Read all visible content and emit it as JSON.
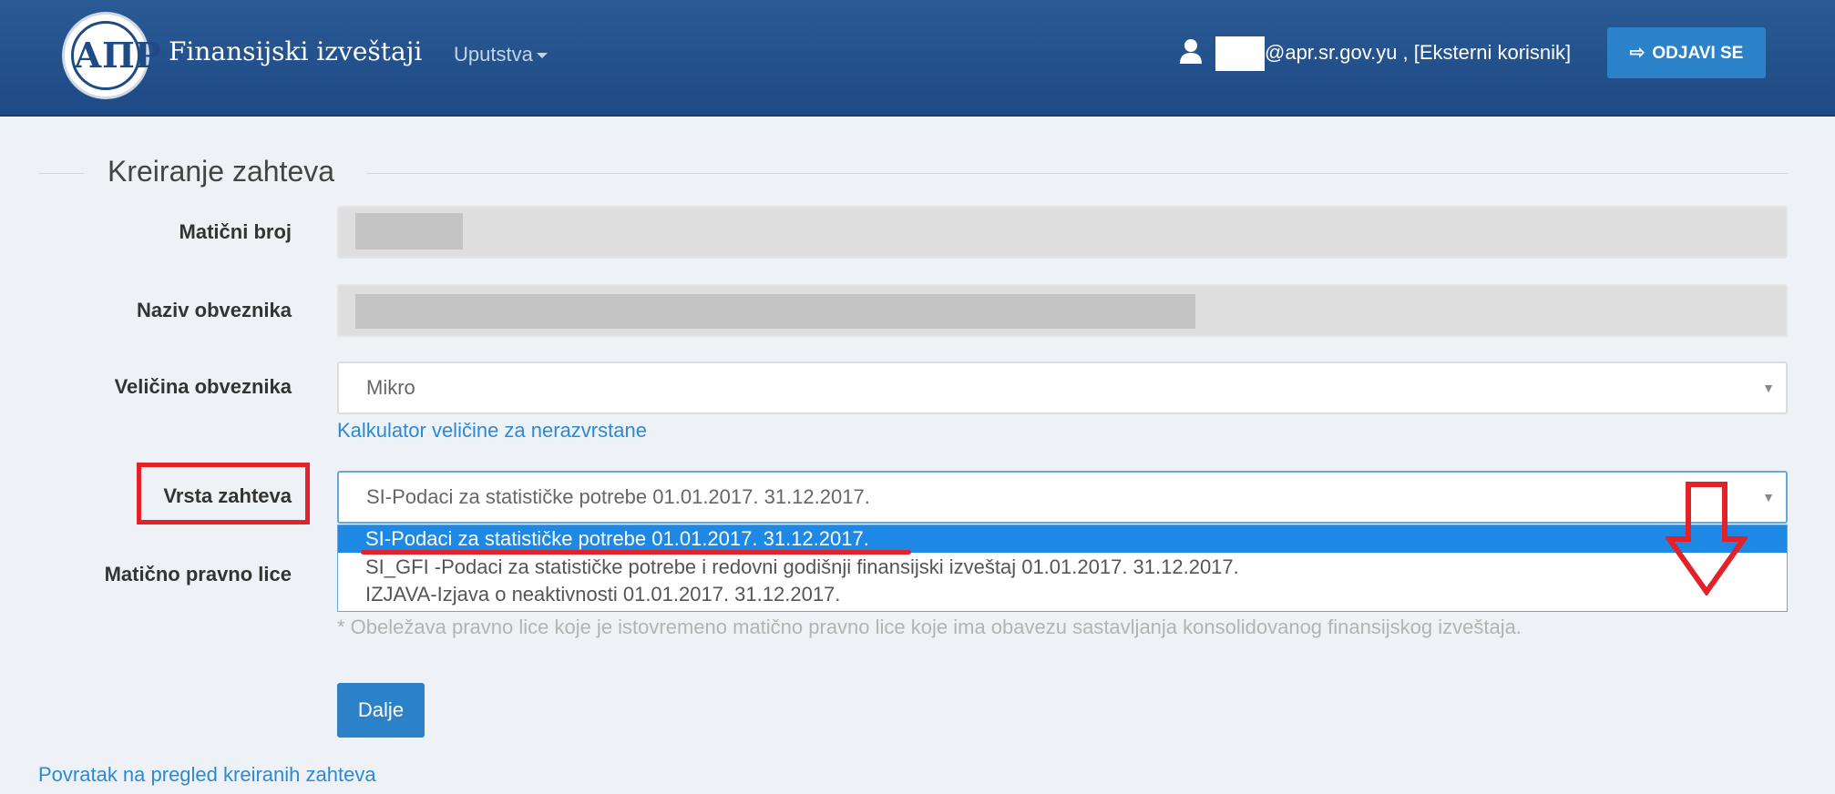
{
  "header": {
    "logo_text": "АПР",
    "title": "Finansijski izveštaji",
    "nav_menu": "Uputstva",
    "user_email": "@apr.sr.gov.yu , [Eksterni korisnik]",
    "logout_label": "ODJAVI SE",
    "colors": {
      "header_bg": "#1e4a85",
      "button_bg": "#2c82c9"
    }
  },
  "form": {
    "legend": "Kreiranje zahteva",
    "fields": {
      "maticni_broj": {
        "label": "Matični broj",
        "value": ""
      },
      "naziv": {
        "label": "Naziv obveznika",
        "value": ""
      },
      "velicina": {
        "label": "Veličina obveznika",
        "selected": "Mikro"
      },
      "kalkulator_link": "Kalkulator veličine za nerazvrstane",
      "vrsta": {
        "label": "Vrsta zahteva",
        "selected": "SI-Podaci za statističke potrebe 01.01.2017. 31.12.2017.",
        "options": [
          "SI-Podaci za statističke potrebe 01.01.2017. 31.12.2017.",
          "SI_GFI -Podaci za statističke potrebe i redovni godišnji finansijski izveštaj 01.01.2017. 31.12.2017.",
          "IZJAVA-Izjava o neaktivnosti 01.01.2017. 31.12.2017."
        ]
      },
      "maticno_pravno_lice": {
        "label": "Matično pravno lice"
      }
    },
    "note": "* Obeležava pravno lice koje je istovremeno matično pravno lice koje ima obavezu sastavljanja konsolidovanog finansijskog izveštaja.",
    "next_button": "Dalje",
    "back_link": "Povratak na pregled kreiranih zahteva",
    "annotation_color": "#e32129",
    "highlight_color": "#1e88e5"
  }
}
